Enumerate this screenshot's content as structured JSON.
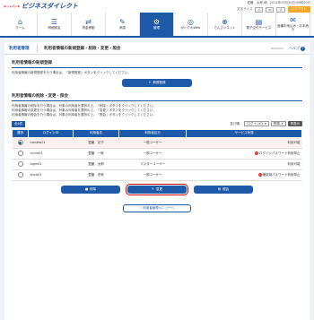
{
  "header": {
    "brand_mark": "ネットバンキ",
    "brand": "ビジネスダイレクト",
    "user_name": "愛媛　太郎 様",
    "last_login": "2014年03月30日 09時00分",
    "font_size_label": "文字サイズ",
    "font_small": "小",
    "font_medium": "中",
    "font_large": "大",
    "logout_label": "ログアウト"
  },
  "nav": [
    {
      "label": "ホーム",
      "icon": "home-icon",
      "glyph": "⌂"
    },
    {
      "label": "明細照会",
      "icon": "list-icon",
      "glyph": "☰"
    },
    {
      "label": "資金移動",
      "icon": "transfer-icon",
      "glyph": "⇄"
    },
    {
      "label": "承認",
      "icon": "approve-icon",
      "glyph": "✎"
    },
    {
      "label": "管理",
      "icon": "admin-icon",
      "glyph": "⚙"
    },
    {
      "label": "がいたわWeb",
      "icon": "globe-icon",
      "glyph": "◎"
    },
    {
      "label": "でんさいネット",
      "icon": "network-icon",
      "glyph": "⊕"
    },
    {
      "label": "電子交付サービス",
      "icon": "document-icon",
      "glyph": "▤"
    },
    {
      "label": "各種お申込み・お手続き",
      "icon": "application-icon",
      "glyph": "✉"
    }
  ],
  "page": {
    "category": "利用者管理",
    "title": "利用者情報の新規登録・削除・変更・照会",
    "screen_id": "BRSK005",
    "help_label": "ヘルプ"
  },
  "new_section": {
    "title": "利用者情報の新規登録",
    "desc": "利用者情報の新規登録を行う場合は、「新規登録」ボタンをクリックしてください。",
    "button": "新規登録"
  },
  "edit_section": {
    "title": "利用者情報の削除・変更・照会",
    "desc1": "利用者情報の削除を行う場合は、対象の利用者を選択の上、「削除」ボタンをクリックしてください。",
    "desc2": "利用者情報の変更を行う場合は、対象の利用者を選択の上、「変更」ボタンをクリックしてください。",
    "desc3": "利用者情報の照会を行う場合は、対象の利用者を選択の上、「照会」ボタンをクリックしてください。",
    "count": "全4件",
    "sort_order": "並び順：",
    "sort_value": "ログインID",
    "sort_dir": "昇順",
    "sort_button": "再表示"
  },
  "table": {
    "headers": [
      "選択",
      "ログインID",
      "利用者名",
      "利用者区分",
      "サービス状態"
    ],
    "rows": [
      {
        "selected": true,
        "login_id": "hanako01",
        "name": "愛媛　花子",
        "type": "一般ユーザー",
        "status": "利用可能",
        "warn": false
      },
      {
        "selected": false,
        "login_id": "ichiro01",
        "name": "愛媛　一郎",
        "type": "一般ユーザー",
        "status": "ログインパスワード利用停止",
        "warn": true
      },
      {
        "selected": false,
        "login_id": "login01",
        "name": "愛媛　太郎",
        "type": "マスターユーザー",
        "status": "利用可能",
        "warn": false
      },
      {
        "selected": false,
        "login_id": "shiro01",
        "name": "愛媛　史郎",
        "type": "一般ユーザー",
        "status": "確認用パスワード利用停止",
        "warn": true
      }
    ]
  },
  "actions": {
    "delete": "削除",
    "change": "変更",
    "inquiry": "照会",
    "back": "利用者管理メニューへ"
  },
  "colors": {
    "primary": "#1e5aa8",
    "logout": "#f5a623",
    "highlight": "#cc0000"
  }
}
